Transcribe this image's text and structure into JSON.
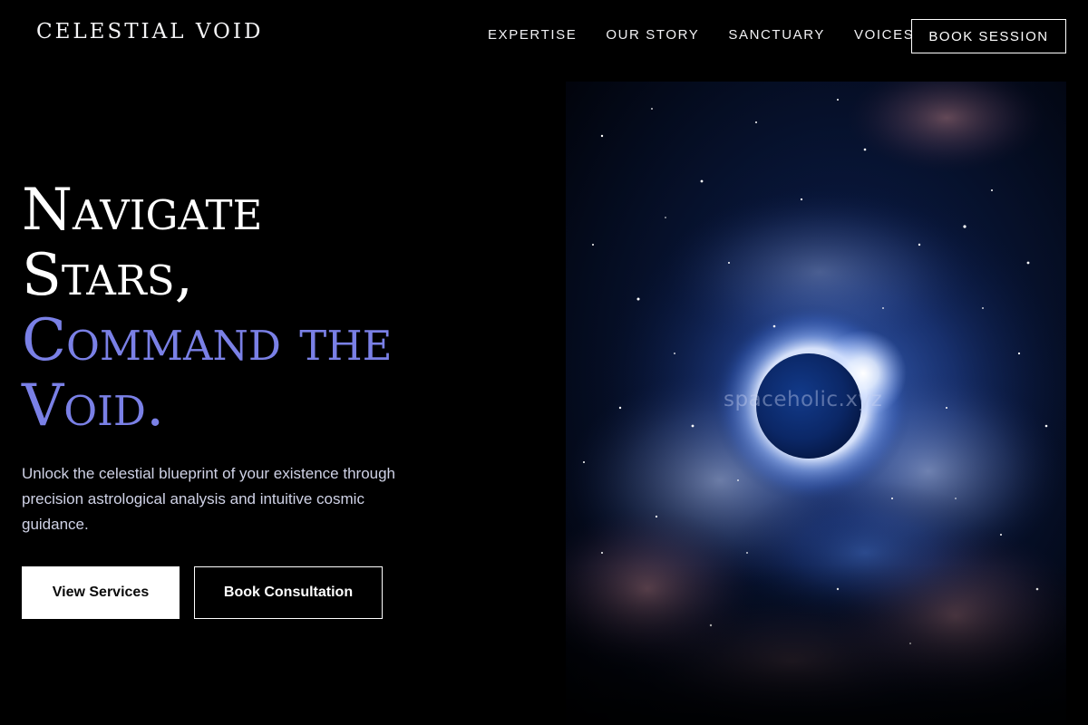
{
  "header": {
    "brand": "CELESTIAL VOID",
    "nav": [
      {
        "label": "EXPERTISE"
      },
      {
        "label": "OUR STORY"
      },
      {
        "label": "SANCTUARY"
      },
      {
        "label": "VOICES"
      }
    ],
    "cta_label": "BOOK SESSION"
  },
  "hero": {
    "headline_lines": [
      "Navigate",
      "Stars,",
      "Command the",
      "Void."
    ],
    "subtitle": "Unlock the celestial blueprint of your existence through precision astrological analysis and intuitive cosmic guidance.",
    "primary_button": "View Services",
    "secondary_button": "Book Consultation",
    "image_watermark": "spaceholic.xyz"
  },
  "colors": {
    "background": "#000000",
    "accent": "#7a80e6",
    "text": "#ffffff",
    "subtitle": "#cfd2e6"
  },
  "icons": {
    "hero_image": "eclipse-nebula-image"
  }
}
